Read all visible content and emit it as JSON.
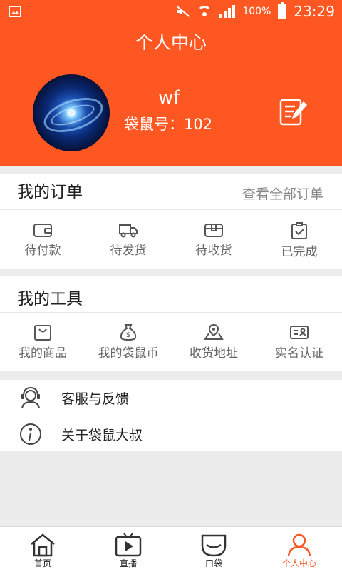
{
  "status_bar": {
    "battery": "100%",
    "time": "23:29"
  },
  "header": {
    "title": "个人中心",
    "username": "wf",
    "user_id": "袋鼠号：102"
  },
  "orders": {
    "title": "我的订单",
    "view_all": "查看全部订单",
    "items": [
      {
        "label": "待付款",
        "icon": "wallet-icon"
      },
      {
        "label": "待发货",
        "icon": "truck-icon"
      },
      {
        "label": "待收货",
        "icon": "package-icon"
      },
      {
        "label": "已完成",
        "icon": "clipboard-check-icon"
      }
    ]
  },
  "tools": {
    "title": "我的工具",
    "items": [
      {
        "label": "我的商品",
        "icon": "shopping-bag-icon"
      },
      {
        "label": "我的袋鼠币",
        "icon": "money-bag-icon"
      },
      {
        "label": "收货地址",
        "icon": "map-pin-icon"
      },
      {
        "label": "实名认证",
        "icon": "id-card-icon"
      }
    ]
  },
  "menu": [
    {
      "label": "客服与反馈",
      "icon": "headset-icon"
    },
    {
      "label": "关于袋鼠大叔",
      "icon": "info-icon"
    }
  ],
  "tabs": [
    {
      "label": "首页",
      "icon": "home-icon"
    },
    {
      "label": "直播",
      "icon": "tv-play-icon"
    },
    {
      "label": "口袋",
      "icon": "pocket-icon"
    },
    {
      "label": "个人中心",
      "icon": "person-icon",
      "active": true
    }
  ],
  "colors": {
    "accent": "#ff5722",
    "background": "#ececec"
  }
}
